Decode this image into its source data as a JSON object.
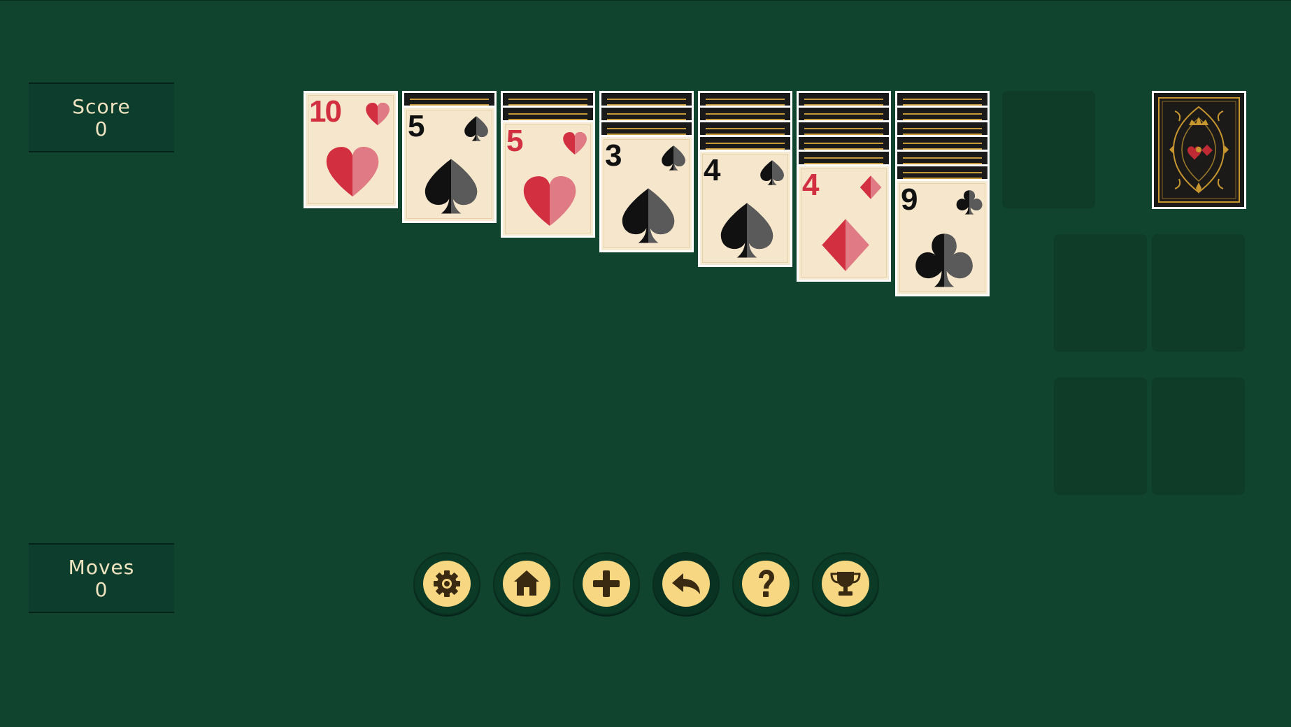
{
  "stats": {
    "score_label": "Score",
    "score_value": "0",
    "moves_label": "Moves",
    "moves_value": "0"
  },
  "tableau": [
    {
      "face_down": 0,
      "top": {
        "rank": "10",
        "suit": "hearts",
        "color": "red"
      }
    },
    {
      "face_down": 1,
      "top": {
        "rank": "5",
        "suit": "spades",
        "color": "black"
      }
    },
    {
      "face_down": 2,
      "top": {
        "rank": "5",
        "suit": "hearts",
        "color": "red"
      }
    },
    {
      "face_down": 3,
      "top": {
        "rank": "3",
        "suit": "spades",
        "color": "black"
      }
    },
    {
      "face_down": 4,
      "top": {
        "rank": "4",
        "suit": "spades",
        "color": "black"
      }
    },
    {
      "face_down": 5,
      "top": {
        "rank": "4",
        "suit": "diamonds",
        "color": "red"
      }
    },
    {
      "face_down": 6,
      "top": {
        "rank": "9",
        "suit": "clubs",
        "color": "black"
      }
    }
  ],
  "waste": {
    "empty": true
  },
  "stock": {
    "face_down": true
  },
  "foundations": [
    {
      "empty": true
    },
    {
      "empty": true
    },
    {
      "empty": true
    },
    {
      "empty": true
    }
  ],
  "toolbar": [
    {
      "name": "settings",
      "icon": "gear-icon"
    },
    {
      "name": "home",
      "icon": "home-icon"
    },
    {
      "name": "new-game",
      "icon": "plus-icon"
    },
    {
      "name": "undo",
      "icon": "undo-arrow-icon"
    },
    {
      "name": "help",
      "icon": "question-icon"
    },
    {
      "name": "trophy",
      "icon": "trophy-icon"
    }
  ],
  "colors": {
    "felt": "#10442f",
    "panel": "#0d3d2c",
    "slot": "#0e3c29",
    "button_disc": "#f7d781",
    "icon": "#3a2a12",
    "red_suit": "#d23041",
    "black_suit": "#111111",
    "card_face": "#f5e6cc",
    "stat_text": "#efe3c0"
  }
}
